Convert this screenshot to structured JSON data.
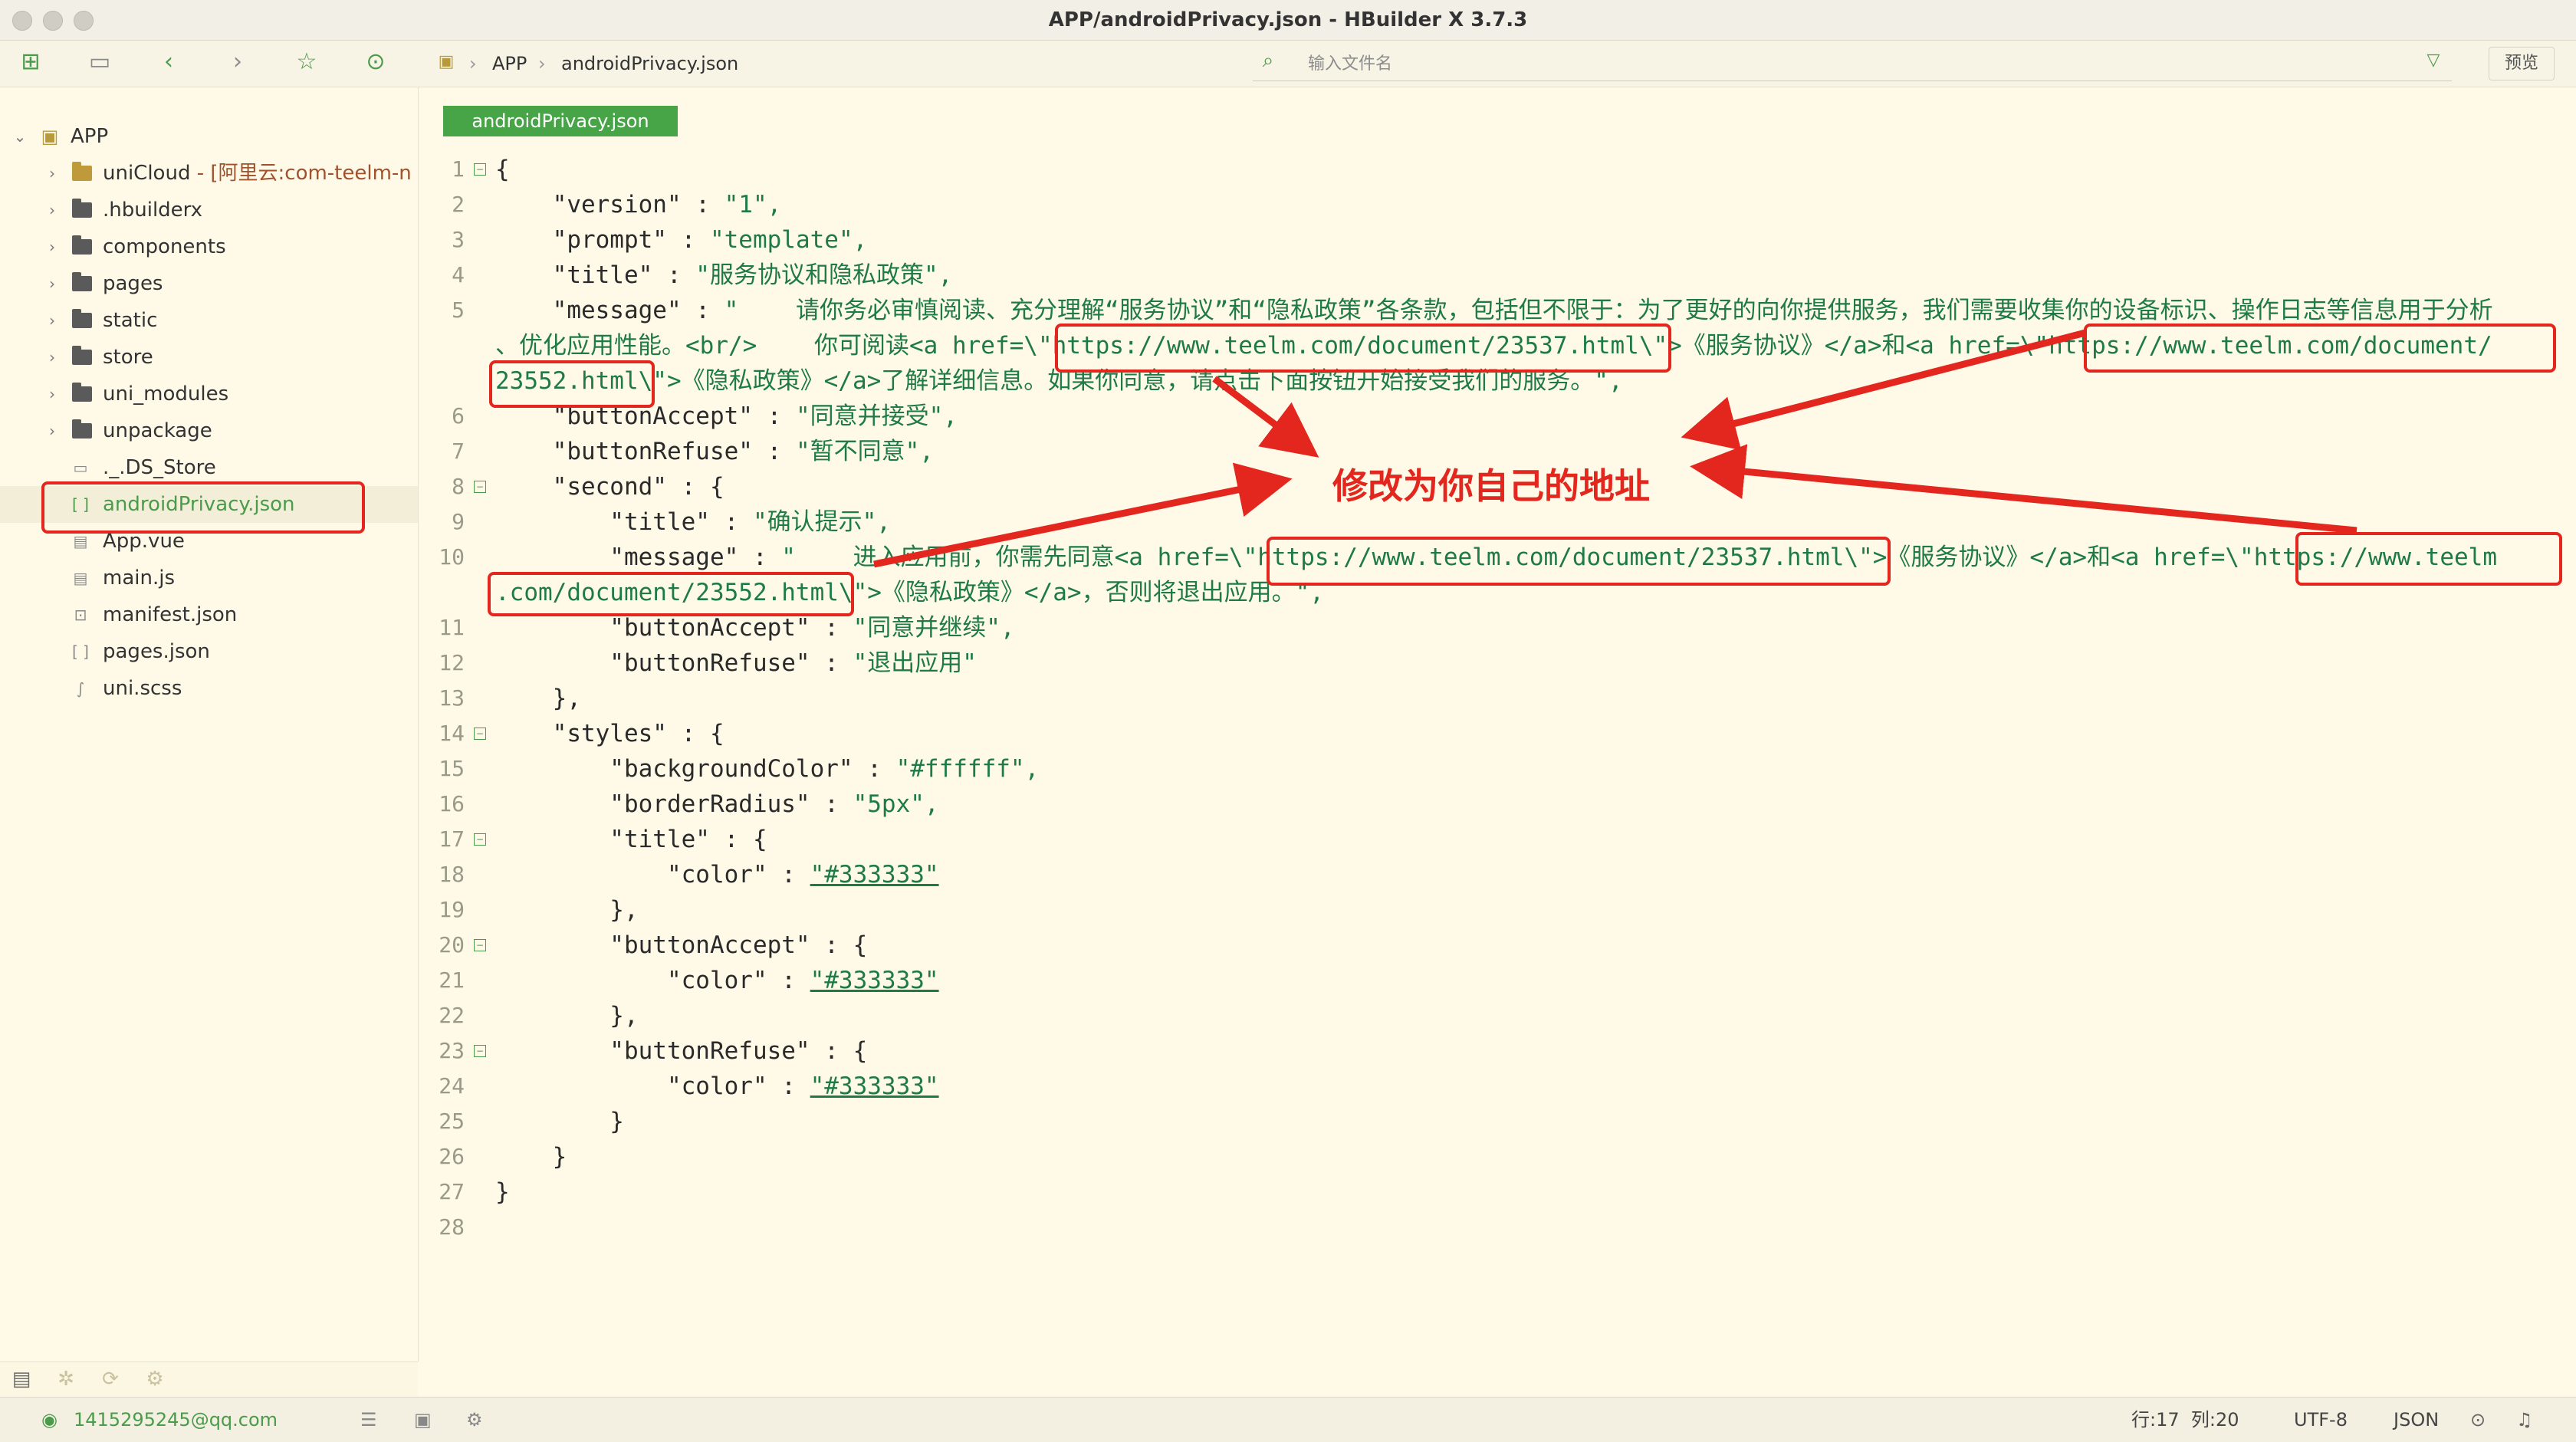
{
  "window": {
    "title": "APP/androidPrivacy.json - HBuilder X 3.7.3"
  },
  "toolbar": {
    "breadcrumb": [
      "APP",
      "androidPrivacy.json"
    ],
    "search_placeholder": "输入文件名",
    "preview_label": "预览"
  },
  "sidebar": {
    "root": "APP",
    "items": [
      {
        "label": "uniCloud",
        "sub": " - [阿里云:com-teelm-n",
        "type": "cloud-folder"
      },
      {
        "label": ".hbuilderx",
        "type": "folder"
      },
      {
        "label": "components",
        "type": "folder"
      },
      {
        "label": "pages",
        "type": "folder"
      },
      {
        "label": "static",
        "type": "folder"
      },
      {
        "label": "store",
        "type": "folder"
      },
      {
        "label": "uni_modules",
        "type": "folder"
      },
      {
        "label": "unpackage",
        "type": "folder"
      },
      {
        "label": "._.DS_Store",
        "type": "file"
      },
      {
        "label": "androidPrivacy.json",
        "type": "json",
        "selected": true
      },
      {
        "label": "App.vue",
        "type": "vue"
      },
      {
        "label": "main.js",
        "type": "js"
      },
      {
        "label": "manifest.json",
        "type": "manifest"
      },
      {
        "label": "pages.json",
        "type": "json"
      },
      {
        "label": "uni.scss",
        "type": "scss"
      }
    ]
  },
  "editor": {
    "tab_label": "androidPrivacy.json",
    "lines": [
      {
        "n": "1",
        "fold": true,
        "k": "{",
        "s": ""
      },
      {
        "n": "2",
        "k": "    \"version\" : ",
        "s": "\"1\","
      },
      {
        "n": "3",
        "k": "    \"prompt\" : ",
        "s": "\"template\","
      },
      {
        "n": "4",
        "k": "    \"title\" : ",
        "s": "\"服务协议和隐私政策\","
      },
      {
        "n": "5",
        "k": "    \"message\" : ",
        "s": "\"    请你务必审慎阅读、充分理解“服务协议”和“隐私政策”各条款，包括但不限于：为了更好的向你提供服务，我们需要收集你的设备标识、操作日志等信息用于分析"
      },
      {
        "n": "",
        "k": "",
        "s": "、优化应用性能。<br/>    你可阅读<a href=\\\"https://www.teelm.com/document/23537.html\\\">《服务协议》</a>和<a href=\\\"https://www.teelm.com/document/"
      },
      {
        "n": "",
        "k": "",
        "s": "23552.html\\\">《隐私政策》</a>了解详细信息。如果你同意，请点击下面按钮开始接受我们的服务。\","
      },
      {
        "n": "6",
        "k": "    \"buttonAccept\" : ",
        "s": "\"同意并接受\","
      },
      {
        "n": "7",
        "k": "    \"buttonRefuse\" : ",
        "s": "\"暂不同意\","
      },
      {
        "n": "8",
        "fold": true,
        "k": "    \"second\" : {",
        "s": ""
      },
      {
        "n": "9",
        "k": "        \"title\" : ",
        "s": "\"确认提示\","
      },
      {
        "n": "10",
        "k": "        \"message\" : ",
        "s": "\"    进入应用前，你需先同意<a href=\\\"https://www.teelm.com/document/23537.html\\\">《服务协议》</a>和<a href=\\\"https://www.teelm"
      },
      {
        "n": "",
        "k": "",
        "s": ".com/document/23552.html\\\">《隐私政策》</a>，否则将退出应用。\","
      },
      {
        "n": "11",
        "k": "        \"buttonAccept\" : ",
        "s": "\"同意并继续\","
      },
      {
        "n": "12",
        "k": "        \"buttonRefuse\" : ",
        "s": "\"退出应用\""
      },
      {
        "n": "13",
        "k": "    },",
        "s": ""
      },
      {
        "n": "14",
        "fold": true,
        "k": "    \"styles\" : {",
        "s": ""
      },
      {
        "n": "15",
        "k": "        \"backgroundColor\" : ",
        "s": "\"#ffffff\","
      },
      {
        "n": "16",
        "k": "        \"borderRadius\" : ",
        "s": "\"5px\","
      },
      {
        "n": "17",
        "fold": true,
        "k": "        \"title\" : {",
        "s": ""
      },
      {
        "n": "18",
        "k": "            \"color\" : ",
        "s": "\"#333333\"",
        "u": true
      },
      {
        "n": "19",
        "k": "        },",
        "s": ""
      },
      {
        "n": "20",
        "fold": true,
        "k": "        \"buttonAccept\" : {",
        "s": ""
      },
      {
        "n": "21",
        "k": "            \"color\" : ",
        "s": "\"#333333\"",
        "u": true
      },
      {
        "n": "22",
        "k": "        },",
        "s": ""
      },
      {
        "n": "23",
        "fold": true,
        "k": "        \"buttonRefuse\" : {",
        "s": ""
      },
      {
        "n": "24",
        "k": "            \"color\" : ",
        "s": "\"#333333\"",
        "u": true
      },
      {
        "n": "25",
        "k": "        }",
        "s": ""
      },
      {
        "n": "26",
        "k": "    }",
        "s": ""
      },
      {
        "n": "27",
        "k": "}",
        "s": ""
      },
      {
        "n": "28",
        "k": "",
        "s": ""
      }
    ]
  },
  "annotation": {
    "text": "修改为你自己的地址",
    "color": "#e3261e"
  },
  "statusbar": {
    "user": "1415295245@qq.com",
    "position": "行:17  列:20",
    "encoding": "UTF-8",
    "language": "JSON"
  },
  "colors": {
    "accent": "#47a447",
    "background": "#fffae8",
    "annotation": "#e3261e"
  }
}
